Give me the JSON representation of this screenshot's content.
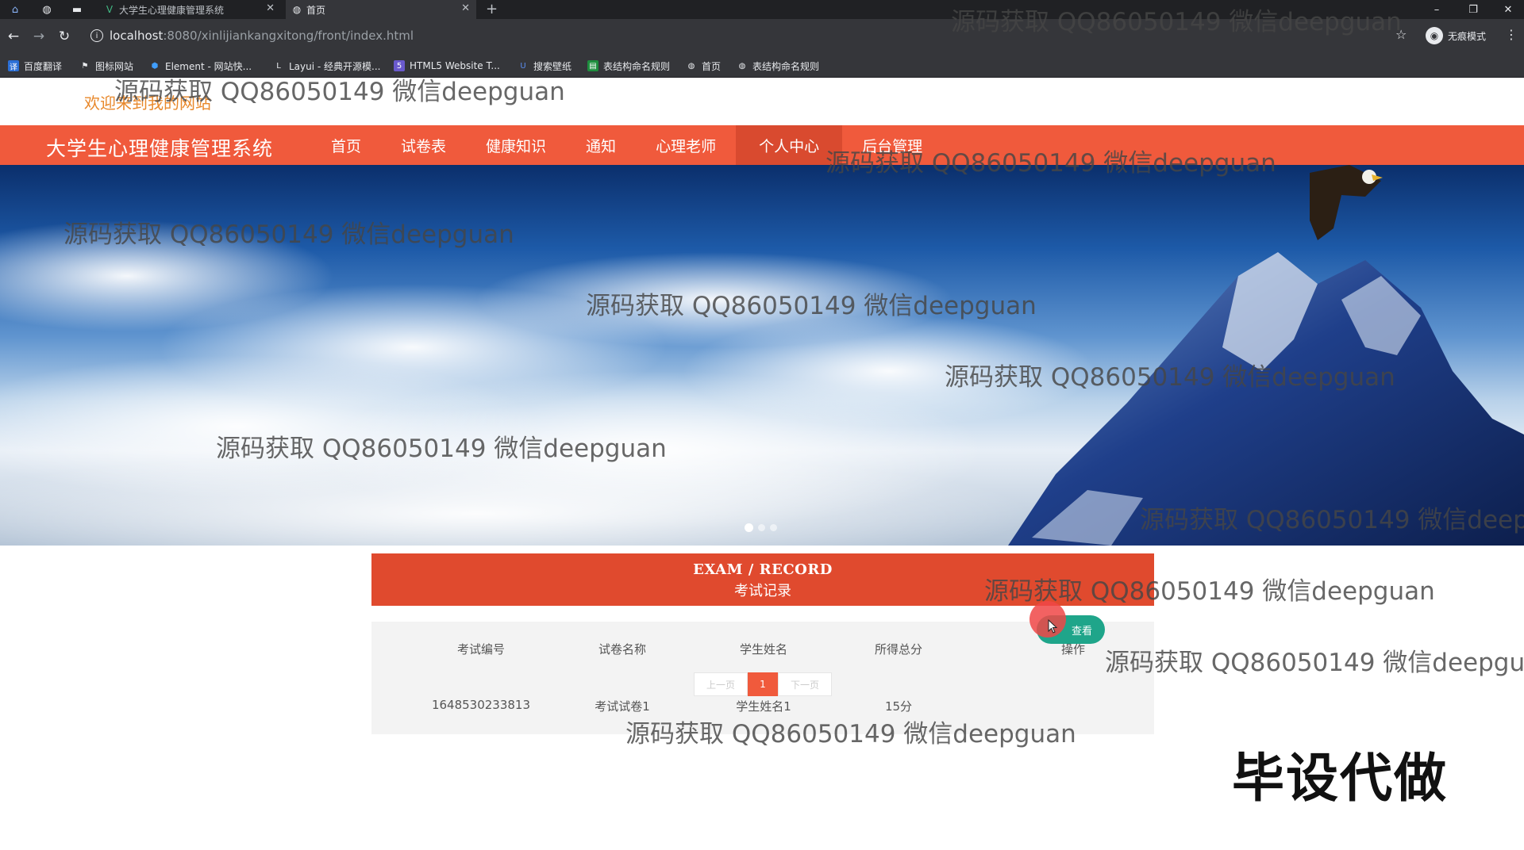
{
  "browser": {
    "tabs": [
      {
        "title": "大学生心理健康管理系统",
        "active": false
      },
      {
        "title": "首页",
        "active": true
      }
    ],
    "new_tab": "+",
    "url_host": "localhost",
    "url_rest": ":8080/xinlijiankangxitong/front/index.html",
    "incognito_label": "无痕模式",
    "bookmarks": [
      "百度翻译",
      "图标网站",
      "Element - 网站快...",
      "Layui - 经典开源模...",
      "HTML5 Website T...",
      "搜索壁纸",
      "表结构命名规则",
      "首页",
      "表结构命名规则"
    ]
  },
  "page": {
    "welcome": "欢迎来到我的网站",
    "brand": "大学生心理健康管理系统",
    "nav": [
      {
        "label": "首页",
        "active": false
      },
      {
        "label": "试卷表",
        "active": false
      },
      {
        "label": "健康知识",
        "active": false
      },
      {
        "label": "通知",
        "active": false
      },
      {
        "label": "心理老师",
        "active": false
      },
      {
        "label": "个人中心",
        "active": true
      },
      {
        "label": "后台管理",
        "active": false
      }
    ],
    "carousel": {
      "slide_count": 3,
      "active_index": 0
    },
    "section": {
      "title_en": "EXAM / RECORD",
      "title_zh": "考试记录"
    },
    "table": {
      "headers": [
        "考试编号",
        "试卷名称",
        "学生姓名",
        "所得总分",
        "操作"
      ],
      "rows": [
        {
          "exam_id": "1648530233813",
          "paper_name": "考试试卷1",
          "student_name": "学生姓名1",
          "score": "15分",
          "action": "查看"
        }
      ]
    },
    "pagination": {
      "prev": "上一页",
      "current": "1",
      "next": "下一页"
    }
  },
  "overlay": {
    "watermark": "源码获取 QQ86050149 微信deepguan",
    "stamp": "毕设代做"
  },
  "colors": {
    "nav_bg": "#f05a3c",
    "nav_active": "#d94a2f",
    "section_head": "#e04a2e",
    "view_button": "#1fa58a",
    "welcome_text": "#e8882b"
  }
}
